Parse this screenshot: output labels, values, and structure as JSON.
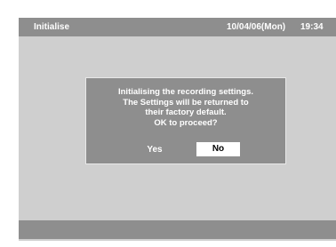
{
  "header": {
    "title": "Initialise",
    "date": "10/04/06(Mon)",
    "time": "19:34"
  },
  "dialog": {
    "message_lines": [
      "Initialising the recording settings.",
      "The Settings will be returned to",
      "their factory default.",
      "OK to proceed?"
    ],
    "yes_label": "Yes",
    "no_label": "No",
    "selected": "No"
  },
  "colors": {
    "screen_bg": "#cfcfcf",
    "bar_bg": "#8e8e8e",
    "text": "#ffffff",
    "selected_button_bg": "#ffffff"
  }
}
